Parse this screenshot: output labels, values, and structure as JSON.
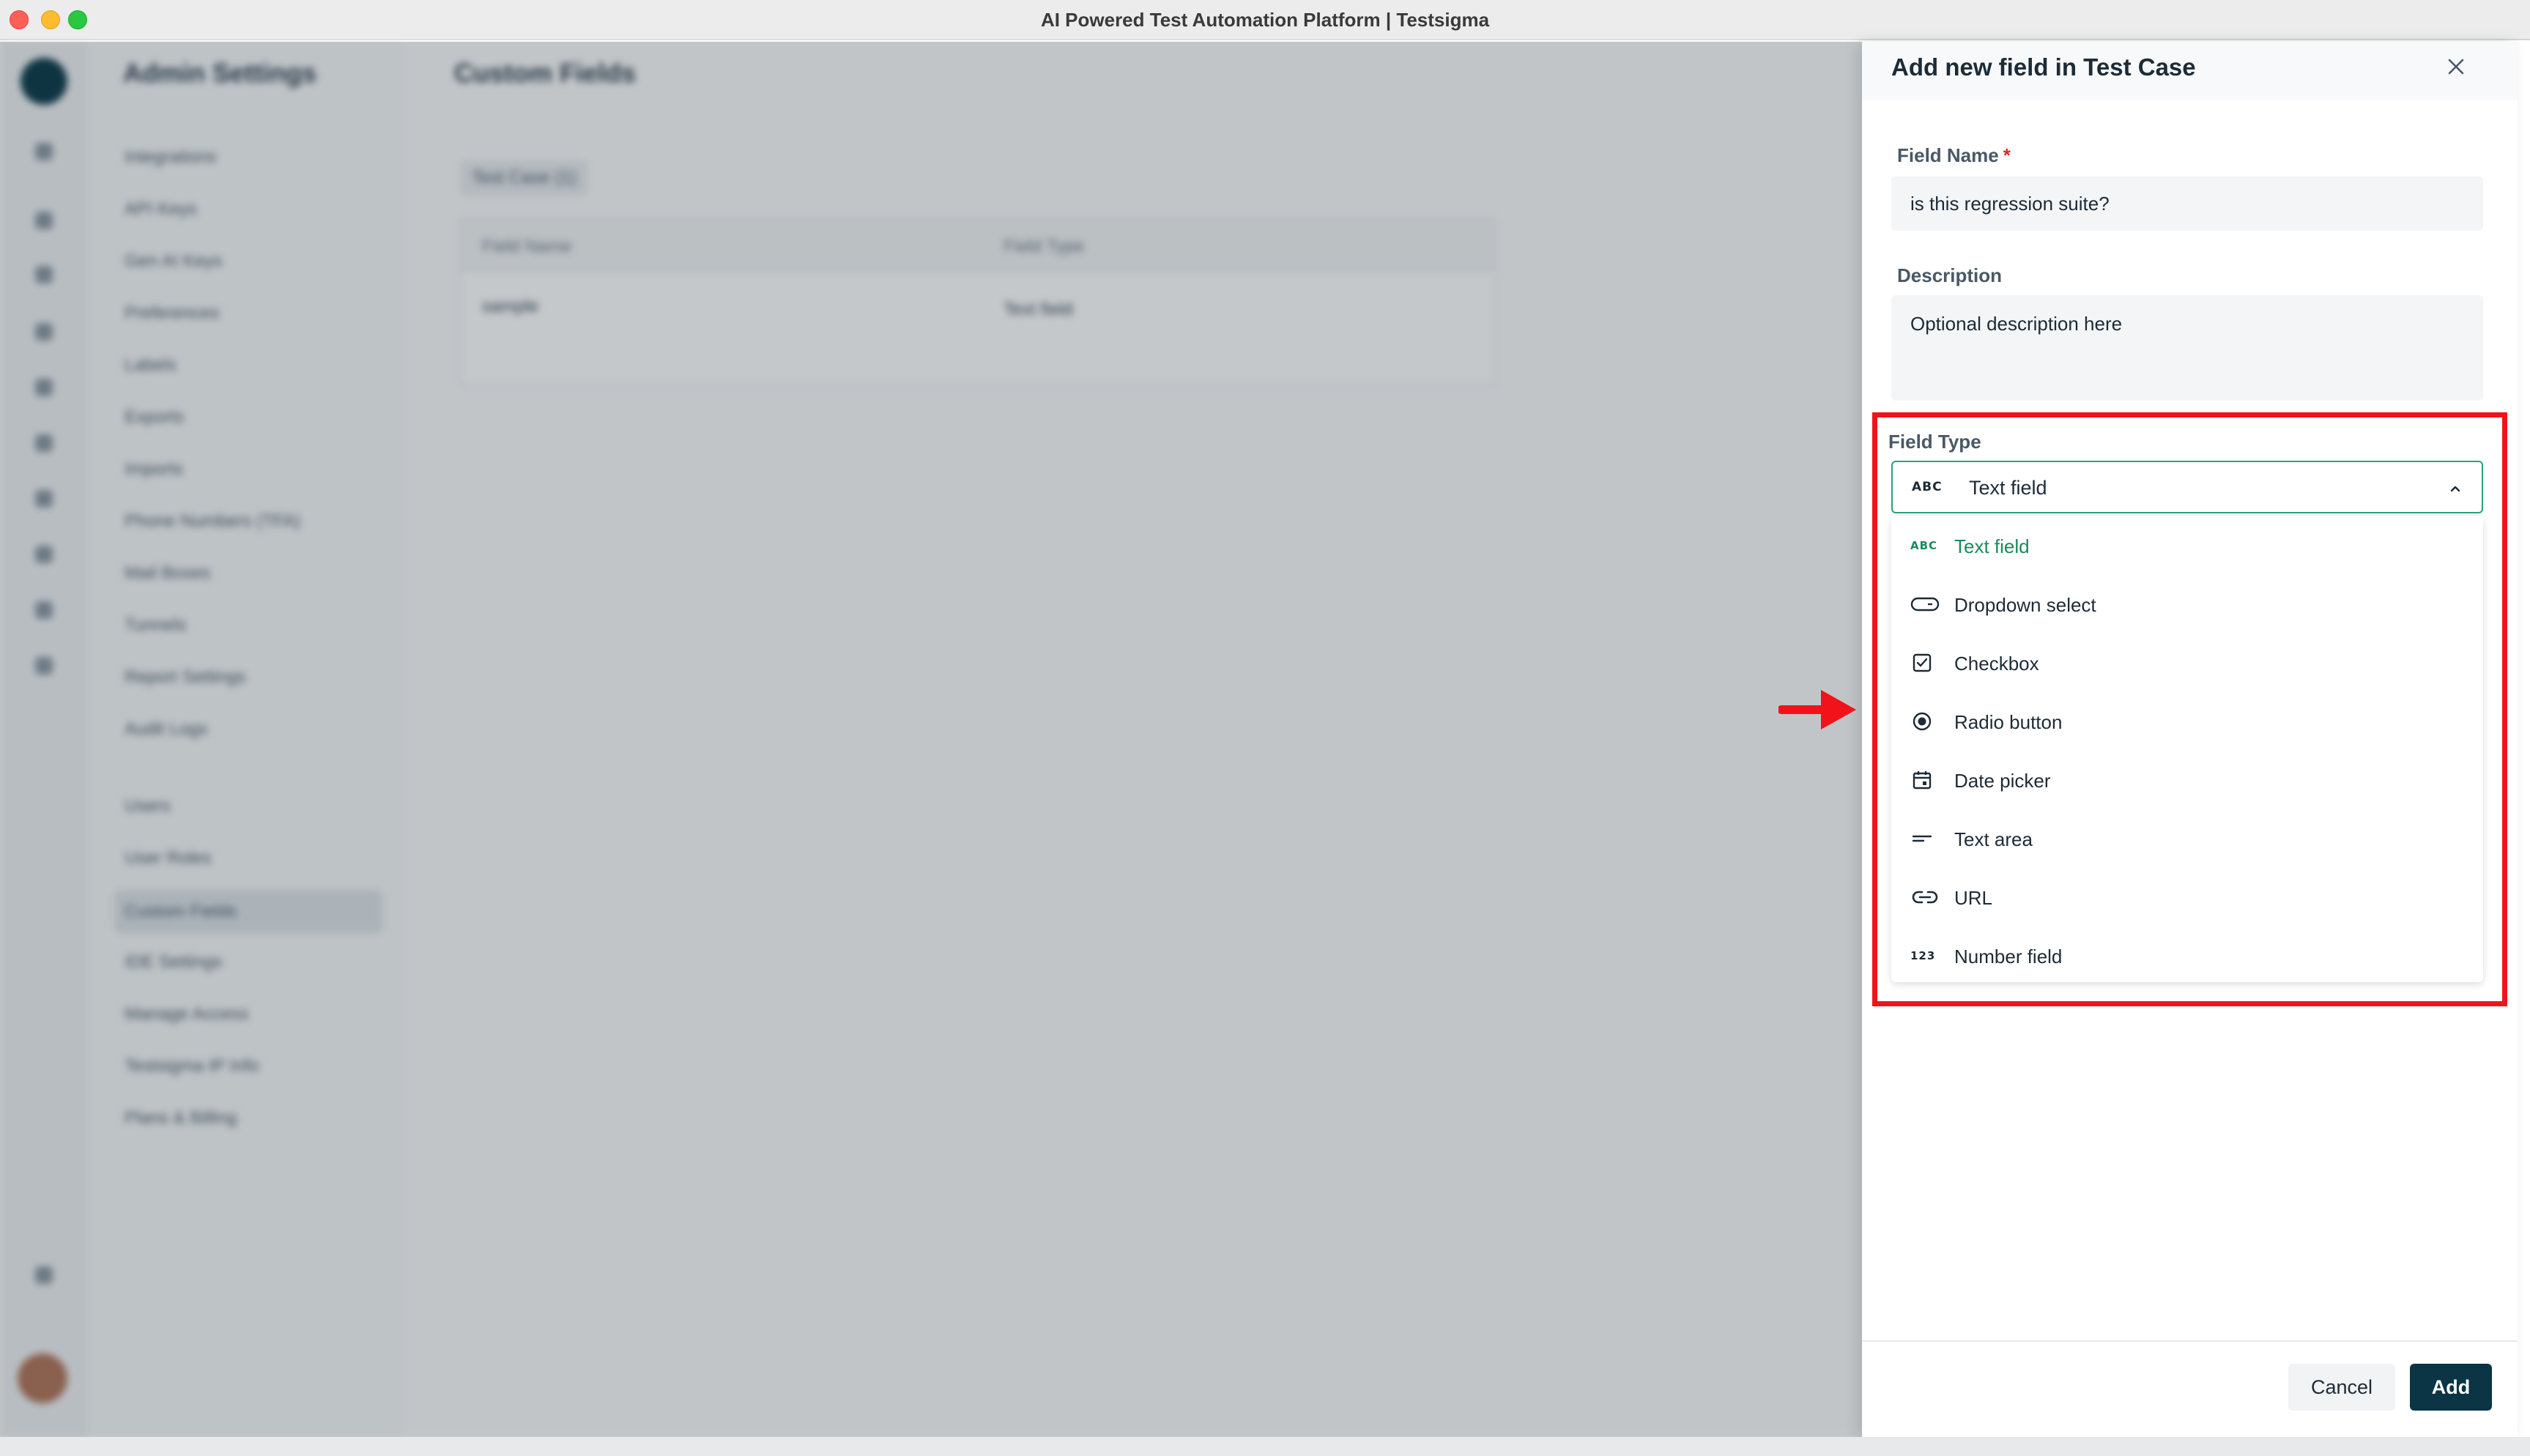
{
  "window": {
    "title": "AI Powered Test Automation Platform | Testsigma"
  },
  "background": {
    "sidebar_heading": "Admin Settings",
    "nav_items": [
      "Integrations",
      "API Keys",
      "Gen AI Keys",
      "Preferences",
      "Labels",
      "Exports",
      "Imports",
      "Phone Numbers (TFA)",
      "Mail Boxes",
      "Tunnels",
      "Report Settings",
      "Audit Logs",
      "Users",
      "User Roles",
      "Custom Fields",
      "IDE Settings",
      "Manage Access",
      "Testsigma IP Info",
      "Plans & Billing"
    ],
    "active_nav": "Custom Fields",
    "content_heading": "Custom Fields",
    "tab_label": "Test Case (1)",
    "table": {
      "headers": [
        "Field Name",
        "Field Type"
      ],
      "rows": [
        [
          "sample",
          "Text field"
        ]
      ]
    }
  },
  "drawer": {
    "title": "Add new field in Test Case",
    "field_name": {
      "label": "Field Name",
      "required_mark": "*",
      "value": "is this regression suite?"
    },
    "description": {
      "label": "Description",
      "placeholder": "Optional description here"
    },
    "field_type": {
      "label": "Field Type",
      "selected_icon": "ABC",
      "selected": "Text field",
      "options": [
        {
          "label": "Text field",
          "icon": "abc-icon",
          "glyph": "ABC"
        },
        {
          "label": "Dropdown select",
          "icon": "dropdown-icon"
        },
        {
          "label": "Checkbox",
          "icon": "checkbox-icon"
        },
        {
          "label": "Radio button",
          "icon": "radio-icon"
        },
        {
          "label": "Date picker",
          "icon": "calendar-icon"
        },
        {
          "label": "Text area",
          "icon": "text-area-icon"
        },
        {
          "label": "URL",
          "icon": "link-icon"
        },
        {
          "label": "Number field",
          "icon": "number-icon",
          "glyph": "123"
        }
      ]
    },
    "footer": {
      "cancel_label": "Cancel",
      "add_label": "Add"
    }
  },
  "colors": {
    "accent_green": "#1a8a5a",
    "primary_dark": "#0b3444",
    "highlight_red": "#f2131a",
    "required_red": "#e02424"
  }
}
